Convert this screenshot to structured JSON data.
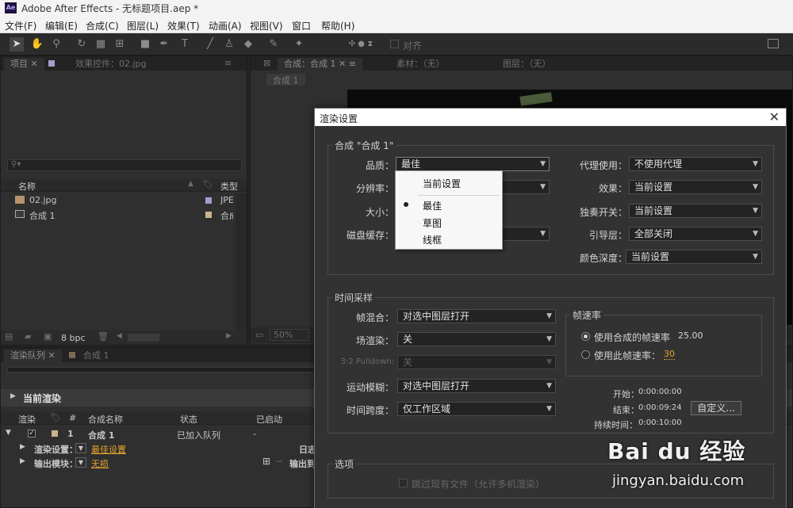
{
  "app": {
    "logo": "Ae",
    "title": "Adobe After Effects - 无标题项目.aep *"
  },
  "menu": [
    "文件(F)",
    "编辑(E)",
    "合成(C)",
    "图层(L)",
    "效果(T)",
    "动画(A)",
    "视图(V)",
    "窗口",
    "帮助(H)"
  ],
  "toolbar": {
    "align_label": "对齐"
  },
  "project_panel": {
    "tab_project": "项目",
    "tab_effects": "效果控件：02.jpg",
    "col_name": "名称",
    "col_type": "类型",
    "items": [
      {
        "name": "02.jpg",
        "type": "JPE"
      },
      {
        "name": "合成 1",
        "type": "合成"
      }
    ],
    "bpc": "8 bpc"
  },
  "comp_panel": {
    "tab_comp": "合成：合成 1",
    "tab_footage": "素材：（无）",
    "tab_layer": "图层：（无）",
    "subtab": "合成 1",
    "zoom": "50%"
  },
  "render_queue": {
    "tab_queue": "渲染队列",
    "tab_comp": "合成 1",
    "current_render": "当前渲染",
    "col_render": "渲染",
    "col_num": "#",
    "col_comp": "合成名称",
    "col_status": "状态",
    "col_started": "已启动",
    "row": {
      "num": "1",
      "comp": "合成 1",
      "status": "已加入队列",
      "started": "-"
    },
    "render_settings_label": "渲染设置：",
    "render_settings_value": "最佳设置",
    "output_module_label": "输出模块：",
    "output_module_value": "无损",
    "log_label": "日志",
    "output_to_label": "输出到"
  },
  "dialog": {
    "title": "渲染设置",
    "close": "✕",
    "comp_group": "合成 \"合成 1\"",
    "quality_label": "品质：",
    "quality_value": "最佳",
    "resolution_label": "分辨率：",
    "size_label": "大小：",
    "disk_cache_label": "磁盘缓存：",
    "proxy_label": "代理使用：",
    "proxy_value": "不使用代理",
    "effects_label": "效果：",
    "effects_value": "当前设置",
    "solo_label": "独奏开关：",
    "solo_value": "当前设置",
    "guide_label": "引导层：",
    "guide_value": "全部关闭",
    "color_depth_label": "颜色深度：",
    "color_depth_value": "当前设置",
    "time_group": "时间采样",
    "frame_blend_label": "帧混合：",
    "frame_blend_value": "对选中图层打开",
    "field_render_label": "场渲染：",
    "field_render_value": "关",
    "pulldown_label": "3:2 Pulldown:",
    "pulldown_value": "关",
    "motion_blur_label": "运动模糊：",
    "motion_blur_value": "对选中图层打开",
    "time_span_label": "时间跨度：",
    "time_span_value": "仅工作区域",
    "frame_rate_group": "帧速率",
    "use_comp_rate": "使用合成的帧速率",
    "comp_rate_value": "25.00",
    "use_this_rate": "使用此帧速率：",
    "this_rate_value": "30",
    "start_label": "开始：",
    "start_value": "0:00:00:00",
    "end_label": "结束：",
    "end_value": "0:00:09:24",
    "custom_button": "自定义...",
    "duration_label": "持续时间：",
    "duration_value": "0:00:10:00",
    "options_group": "选项",
    "skip_existing": "跳过现有文件（允许多机渲染）"
  },
  "quality_menu": {
    "current": "当前设置",
    "best": "最佳",
    "draft": "草图",
    "wireframe": "线框"
  },
  "watermark": {
    "brand": "Bai du 经验",
    "url": "jingyan.baidu.com"
  }
}
